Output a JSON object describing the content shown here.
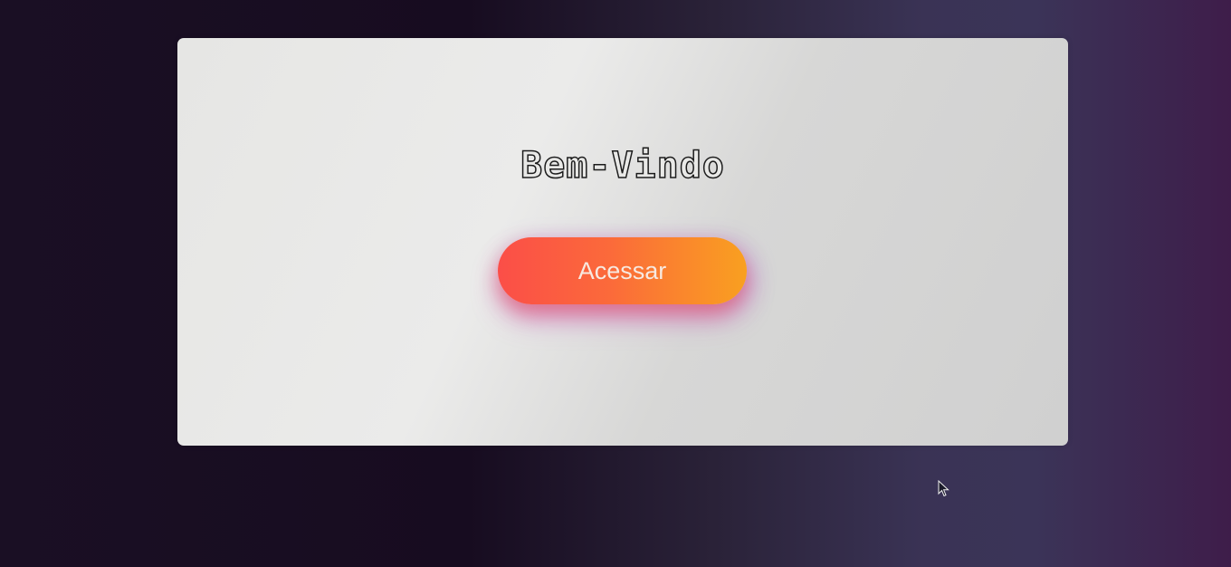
{
  "welcome": {
    "title": "Bem-Vindo",
    "button_label": "Acessar"
  },
  "colors": {
    "button_start": "#fb4e48",
    "button_end": "#f9a020",
    "card_background": "#e8e8e6",
    "page_background_dark": "#170c20",
    "page_background_accent": "#3e1d4a"
  },
  "icons": {
    "cursor": "mouse-pointer-icon"
  }
}
